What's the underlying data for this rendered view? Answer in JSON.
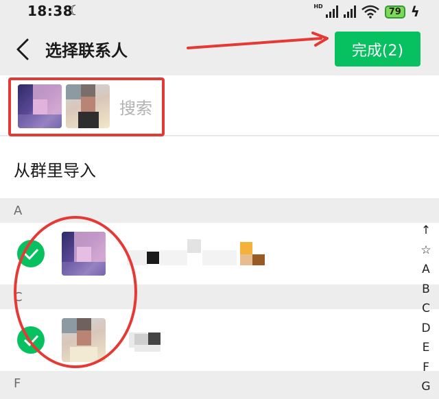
{
  "status": {
    "time": "18:38",
    "hd": "HD",
    "battery": "79"
  },
  "nav": {
    "title": "选择联系人",
    "done_label": "完成(2)"
  },
  "search": {
    "placeholder": "搜索"
  },
  "import": {
    "label": "从群里导入"
  },
  "sections": [
    "A",
    "C",
    "F"
  ],
  "contacts": [
    {
      "section": "A",
      "selected": true
    },
    {
      "section": "C",
      "selected": true
    }
  ],
  "index_bar": [
    "↑",
    "☆",
    "A",
    "B",
    "C",
    "D",
    "E",
    "F",
    "G"
  ],
  "colors": {
    "accent": "#07c160",
    "annotation": "#e53935"
  }
}
